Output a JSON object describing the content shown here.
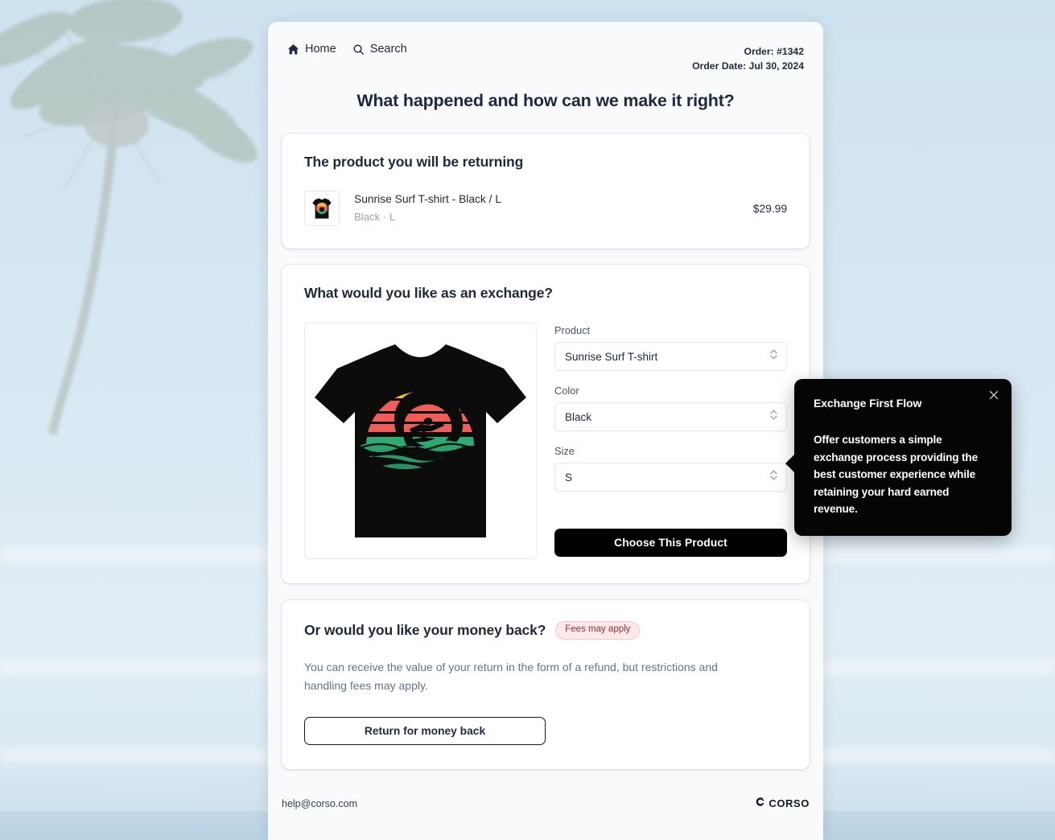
{
  "background": {
    "scene_alt": "faded beach palm tree and pier",
    "sky_color": "#d5e7f2"
  },
  "nav": {
    "items": [
      {
        "label": "Home",
        "icon": "home-icon"
      },
      {
        "label": "Search",
        "icon": "search-icon"
      }
    ]
  },
  "order": {
    "number_line": "Order: #1342",
    "date_line": "Order Date: Jul 30, 2024"
  },
  "page": {
    "title": "What happened and how can we make it right?"
  },
  "returning": {
    "title": "The product you will be returning",
    "product_name": "Sunrise Surf T-shirt - Black / L",
    "product_variant": "Black · L",
    "price": "$29.99"
  },
  "exchange": {
    "title": "What would you like as an exchange?",
    "image_alt": "Sunrise Surf T-shirt in black",
    "fields": [
      {
        "label": "Product",
        "value": "Sunrise Surf T-shirt"
      },
      {
        "label": "Color",
        "value": "Black"
      },
      {
        "label": "Size",
        "value": "S"
      }
    ],
    "submit_label": "Choose This Product"
  },
  "moneyback": {
    "title": "Or would you like your money back?",
    "badge": "Fees may apply",
    "description": "You can receive the value of your return in the form of a refund, but restrictions and handling fees may apply.",
    "button_label": "Return for money back"
  },
  "footer": {
    "email": "help@corso.com",
    "logo_text": "CORSO"
  },
  "tooltip": {
    "title": "Exchange First Flow",
    "body": "Offer customers a simple exchange process providing the best customer experience while retaining your hard earned revenue.",
    "close_icon": "close-icon"
  },
  "colors": {
    "accent_black": "#000000",
    "page_bg": "#f8fafc",
    "badge_bg": "#fde9ea",
    "badge_text": "#9f2c38",
    "shirt_yellow": "#f5b942",
    "shirt_red": "#ef5f57",
    "shirt_green": "#2faa72"
  }
}
